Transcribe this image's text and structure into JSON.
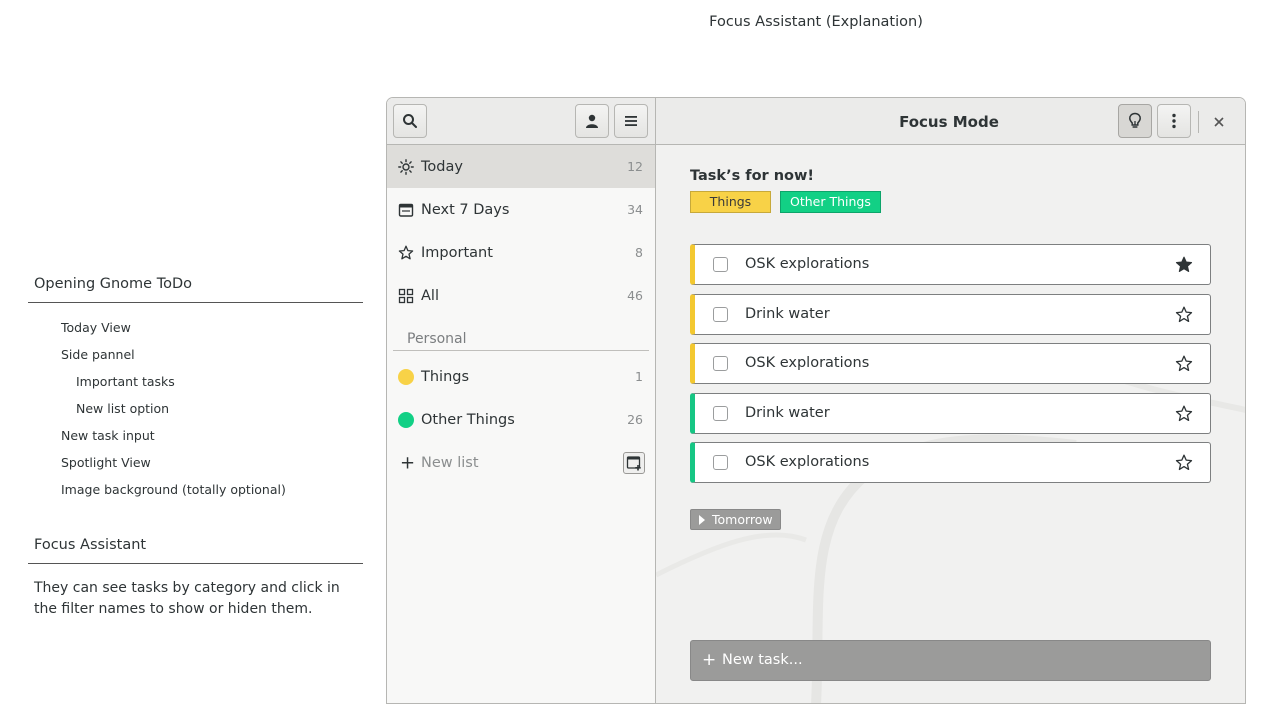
{
  "page": {
    "title": "Focus Assistant (Explanation)"
  },
  "outline": {
    "heading1": "Opening Gnome ToDo",
    "items": [
      {
        "label": "Today View",
        "level": 1
      },
      {
        "label": "Side pannel",
        "level": 1
      },
      {
        "label": "Important tasks",
        "level": 2
      },
      {
        "label": "New list option",
        "level": 2
      },
      {
        "label": "New task input",
        "level": 1
      },
      {
        "label": "Spotlight View",
        "level": 1
      },
      {
        "label": "Image background (totally optional)",
        "level": 1
      }
    ],
    "heading2": "Focus Assistant",
    "description": "They can see tasks by category and click in the filter names to show or hiden them."
  },
  "sidebar": {
    "nav": [
      {
        "label": "Today",
        "count": "12",
        "icon": "sun-icon",
        "active": true
      },
      {
        "label": "Next 7 Days",
        "count": "34",
        "icon": "calendar-icon",
        "active": false
      },
      {
        "label": "Important",
        "count": "8",
        "icon": "star-icon",
        "active": false
      },
      {
        "label": "All",
        "count": "46",
        "icon": "grid-icon",
        "active": false
      }
    ],
    "section_label": "Personal",
    "lists": [
      {
        "label": "Things",
        "count": "1",
        "color": "#f8d247"
      },
      {
        "label": "Other Things",
        "count": "26",
        "color": "#12d085"
      }
    ],
    "new_list_label": "New list"
  },
  "header": {
    "title": "Focus Mode"
  },
  "main": {
    "section_title": "Task’s for now!",
    "filters": [
      {
        "label": "Things",
        "color": "#f8d247"
      },
      {
        "label": "Other Things",
        "color": "#12d085"
      }
    ],
    "tasks": [
      {
        "title": "OSK explorations",
        "category": "Things",
        "starred": true
      },
      {
        "title": "Drink water",
        "category": "Things",
        "starred": false
      },
      {
        "title": "OSK explorations",
        "category": "Things",
        "starred": false
      },
      {
        "title": "Drink water",
        "category": "Other Things",
        "starred": false
      },
      {
        "title": "OSK explorations",
        "category": "Other Things",
        "starred": false
      }
    ],
    "tomorrow_label": "Tomorrow",
    "new_task_placeholder": "New task..."
  }
}
